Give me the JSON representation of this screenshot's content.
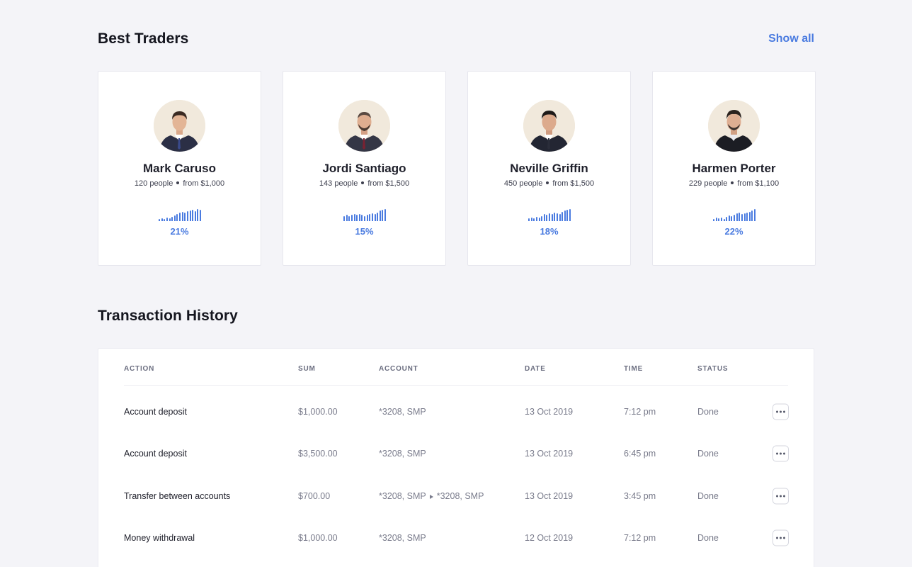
{
  "best_traders": {
    "title": "Best Traders",
    "show_all_label": "Show all",
    "accent_color": "#4a7be0",
    "traders": [
      {
        "name": "Mark Caruso",
        "people": "120 people",
        "from": "from $1,000",
        "percent": "21%",
        "spark": [
          3,
          4,
          3,
          5,
          4,
          6,
          8,
          10,
          12,
          13,
          12,
          14,
          15,
          16,
          14,
          17,
          16
        ]
      },
      {
        "name": "Jordi Santiago",
        "people": "143 people",
        "from": "from $1,500",
        "percent": "15%",
        "spark": [
          6,
          7,
          6,
          7,
          8,
          7,
          8,
          7,
          6,
          7,
          8,
          9,
          8,
          10,
          12,
          13,
          14
        ]
      },
      {
        "name": "Neville Griffin",
        "people": "450 people",
        "from": "from $1,500",
        "percent": "18%",
        "spark": [
          4,
          5,
          4,
          6,
          5,
          7,
          9,
          8,
          10,
          9,
          11,
          10,
          9,
          12,
          14,
          15,
          16
        ]
      },
      {
        "name": "Harmen Porter",
        "people": "229 people",
        "from": "from $1,100",
        "percent": "22%",
        "spark": [
          3,
          5,
          4,
          5,
          3,
          6,
          8,
          7,
          9,
          11,
          12,
          10,
          11,
          12,
          13,
          15,
          17
        ]
      }
    ]
  },
  "transactions": {
    "title": "Transaction History",
    "columns": {
      "action": "ACTION",
      "sum": "SUM",
      "account": "ACCOUNT",
      "date": "DATE",
      "time": "TIME",
      "status": "STATUS"
    },
    "rows": [
      {
        "action": "Account deposit",
        "sum": "$1,000.00",
        "account_from": "*3208, SMP",
        "account_to": "",
        "date": "13 Oct 2019",
        "time": "7:12 pm",
        "status": "Done"
      },
      {
        "action": "Account deposit",
        "sum": "$3,500.00",
        "account_from": "*3208, SMP",
        "account_to": "",
        "date": "13 Oct 2019",
        "time": "6:45 pm",
        "status": "Done"
      },
      {
        "action": "Transfer between accounts",
        "sum": "$700.00",
        "account_from": "*3208, SMP",
        "account_to": "*3208, SMP",
        "date": "13 Oct 2019",
        "time": "3:45 pm",
        "status": "Done"
      },
      {
        "action": "Money withdrawal",
        "sum": "$1,000.00",
        "account_from": "*3208, SMP",
        "account_to": "",
        "date": "12 Oct 2019",
        "time": "7:12 pm",
        "status": "Done"
      }
    ]
  }
}
